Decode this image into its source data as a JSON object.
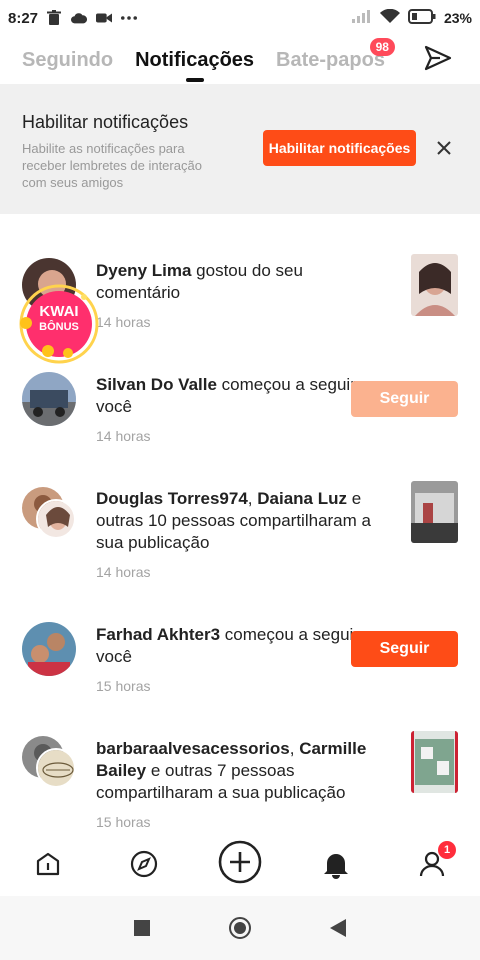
{
  "status_bar": {
    "time": "8:27",
    "battery_percent": "23%",
    "icons": [
      "trash-icon",
      "cloud-icon",
      "video-icon",
      "more-dots-icon",
      "signal-icon",
      "wifi-icon",
      "battery-icon"
    ]
  },
  "tabs": [
    {
      "label": "Seguindo",
      "active": false
    },
    {
      "label": "Notificações",
      "active": true
    },
    {
      "label": "Bate-papos",
      "active": false,
      "badge": "98"
    }
  ],
  "banner": {
    "title": "Habilitar notificações",
    "description": "Habilite as notificações para receber lembretes de interação com seus amigos",
    "button_label": "Habilitar notificações"
  },
  "notifications": [
    {
      "actor": "Dyeny Lima",
      "action": " gostou do seu comentário",
      "time": "14 horas",
      "accessory": "thumbnail"
    },
    {
      "actor": "Silvan Do Valle",
      "action": " começou a seguir você",
      "time": "14 horas",
      "accessory": "follow",
      "button_label": "Seguir"
    },
    {
      "actor": "Douglas Torres974",
      "separator": ", ",
      "actor2": "Daiana Luz",
      "action": " e outras 10 pessoas compartilharam a sua publicação",
      "time": "14 horas",
      "accessory": "thumbnail"
    },
    {
      "actor": "Farhad Akhter3",
      "action": " começou a seguir você",
      "time": "15 horas",
      "accessory": "follow",
      "button_label": "Seguir"
    },
    {
      "actor": "barbaraalvesacessorios",
      "separator": ", ",
      "actor2": "Carmille Bailey",
      "action": " e outras 7 pessoas compartilharam a sua publicação",
      "time": "15 horas",
      "accessory": "thumbnail"
    }
  ],
  "kwai_bonus": {
    "line1": "KWAI",
    "line2": "BÔNUS"
  },
  "bottom_nav": {
    "items": [
      "home-icon",
      "discover-icon",
      "create-icon",
      "notifications-icon",
      "profile-icon"
    ],
    "profile_badge": "1"
  },
  "colors": {
    "accent": "#fe4c17",
    "follow_faded": "#fbb28f",
    "badge_red": "#ff4a5a",
    "banner_bg": "#f0f0f0"
  }
}
